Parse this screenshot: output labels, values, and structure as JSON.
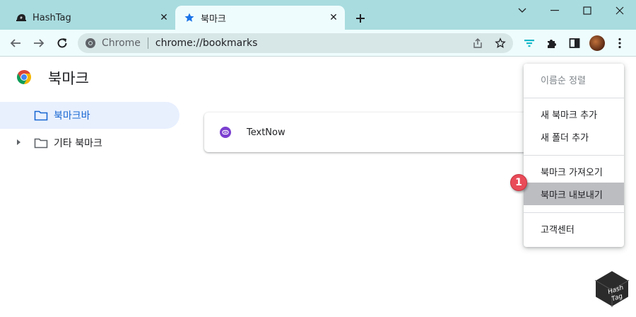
{
  "browser": {
    "tabs": [
      {
        "title": "HashTag",
        "icon": "hashtag-logo-icon",
        "close": "✕"
      },
      {
        "title": "북마크",
        "icon": "star-icon",
        "close": "✕"
      }
    ],
    "new_tab_icon": "plus-icon",
    "window_controls": [
      "chevron-down-icon",
      "minimize-icon",
      "maximize-icon",
      "close-icon"
    ]
  },
  "toolbar": {
    "site_chip": "Chrome",
    "url": "chrome://bookmarks",
    "icons": [
      "back-arrow-icon",
      "forward-arrow-icon",
      "reload-icon",
      "share-icon",
      "bookmark-star-icon",
      "filter-icon",
      "extensions-puzzle-icon",
      "side-panel-icon",
      "profile-avatar",
      "kebab-menu-icon"
    ]
  },
  "page": {
    "title": "북마크",
    "sidebar": [
      {
        "label": "북마크바",
        "active": true
      },
      {
        "label": "기타 북마크",
        "active": false
      }
    ],
    "bookmarks": [
      {
        "label": "TextNow"
      }
    ]
  },
  "menu": {
    "items": [
      {
        "label": "이름순 정렬",
        "disabled": true
      },
      {
        "label": "새 북마크 추가"
      },
      {
        "label": "새 폴더 추가"
      },
      {
        "label": "북마크 가져오기"
      },
      {
        "label": "북마크 내보내기",
        "highlighted": true
      },
      {
        "label": "고객센터"
      }
    ]
  },
  "annotation": {
    "step": "1"
  },
  "watermark": {
    "line1": "Hash",
    "line2": "Tag"
  },
  "colors": {
    "tabstrip": "#a9dcdf",
    "active_tab": "#eefcfd",
    "sidebar_active_bg": "#e8f0fe",
    "sidebar_active_text": "#1967d2",
    "menu_highlight": "#bcbdc1",
    "badge": "#e94b58"
  }
}
